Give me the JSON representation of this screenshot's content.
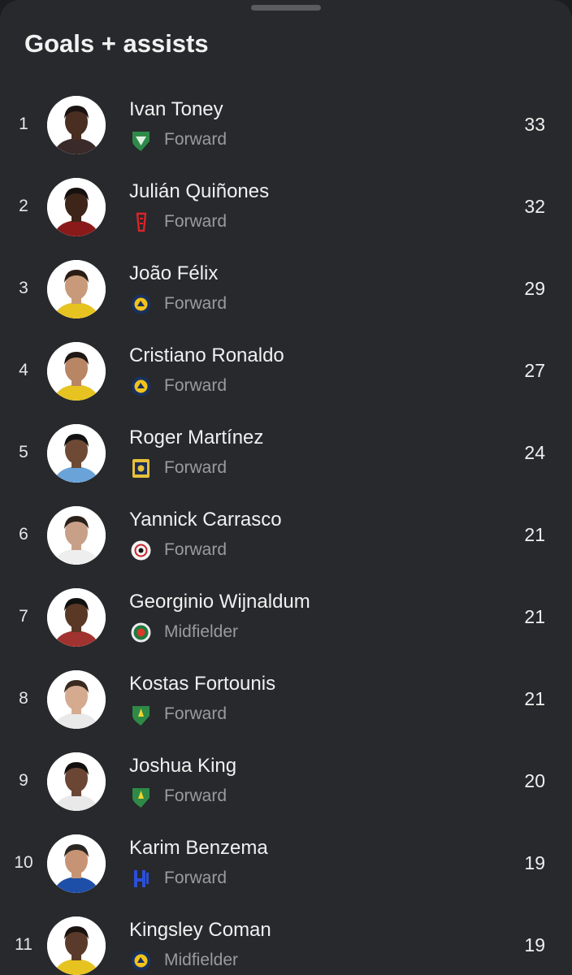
{
  "sheet": {
    "title": "Goals + assists"
  },
  "players": [
    {
      "rank": "1",
      "name": "Ivan Toney",
      "position": "Forward",
      "value": "33",
      "club_icon": "al-ahli-crest-icon"
    },
    {
      "rank": "2",
      "name": "Julián Quiñones",
      "position": "Forward",
      "value": "32",
      "club_icon": "al-qadsiah-crest-icon"
    },
    {
      "rank": "3",
      "name": "João Félix",
      "position": "Forward",
      "value": "29",
      "club_icon": "al-nassr-crest-icon"
    },
    {
      "rank": "4",
      "name": "Cristiano Ronaldo",
      "position": "Forward",
      "value": "27",
      "club_icon": "al-nassr-crest-icon"
    },
    {
      "rank": "5",
      "name": "Roger Martínez",
      "position": "Forward",
      "value": "24",
      "club_icon": "al-taawoun-crest-icon"
    },
    {
      "rank": "6",
      "name": "Yannick Carrasco",
      "position": "Forward",
      "value": "21",
      "club_icon": "al-shabab-crest-icon"
    },
    {
      "rank": "7",
      "name": "Georginio Wijnaldum",
      "position": "Midfielder",
      "value": "21",
      "club_icon": "al-ettifaq-crest-icon"
    },
    {
      "rank": "8",
      "name": "Kostas Fortounis",
      "position": "Forward",
      "value": "21",
      "club_icon": "al-khaleej-crest-icon"
    },
    {
      "rank": "9",
      "name": "Joshua King",
      "position": "Forward",
      "value": "20",
      "club_icon": "al-khaleej-crest-icon"
    },
    {
      "rank": "10",
      "name": "Karim Benzema",
      "position": "Forward",
      "value": "19",
      "club_icon": "al-hilal-crest-icon"
    },
    {
      "rank": "11",
      "name": "Kingsley Coman",
      "position": "Midfielder",
      "value": "19",
      "club_icon": "al-nassr-crest-icon"
    }
  ],
  "colors": {
    "background": "#27292c",
    "text_primary": "#f0f0f0",
    "text_secondary": "#9a9b9e"
  }
}
